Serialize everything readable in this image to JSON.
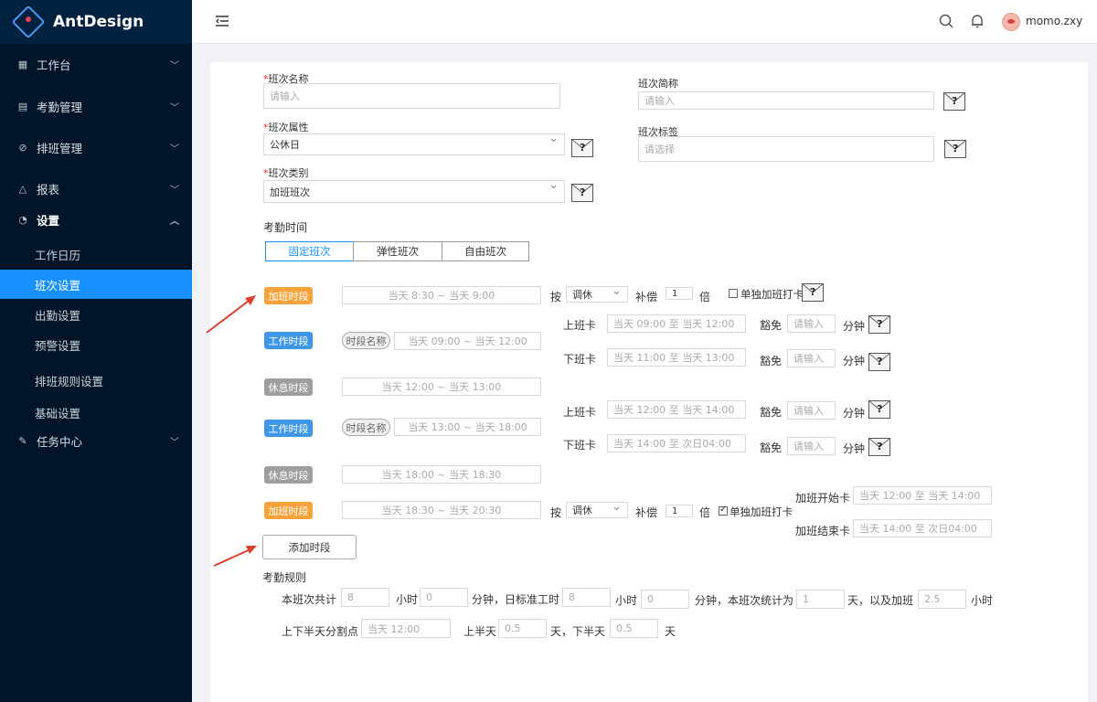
{
  "app": {
    "title": "AntDesign"
  },
  "sidebar": {
    "items": [
      {
        "label": "工作台",
        "icon": "table-icon"
      },
      {
        "label": "考勤管理",
        "icon": "file-icon"
      },
      {
        "label": "排班管理",
        "icon": "check-circle-icon"
      },
      {
        "label": "报表",
        "icon": "warning-icon"
      },
      {
        "label": "设置",
        "icon": "dashboard-icon",
        "expanded": true
      }
    ],
    "settings_sub": [
      "工作日历",
      "班次设置",
      "出勤设置",
      "预警设置",
      "排班规则设置",
      "基础设置"
    ],
    "active_sub": "班次设置",
    "task_center": {
      "label": "任务中心",
      "icon": "edit-icon"
    }
  },
  "header": {
    "username": "momo.zxy"
  },
  "form": {
    "shift_name": {
      "label": "班次名称",
      "placeholder": "请输入"
    },
    "shift_abbr": {
      "label": "班次简称",
      "placeholder": "请输入"
    },
    "shift_attr": {
      "label": "班次属性",
      "value": "公休日"
    },
    "shift_tag": {
      "label": "班次标签",
      "placeholder": "请选择"
    },
    "shift_type": {
      "label": "班次类别",
      "value": "加班班次"
    },
    "attendance_time_title": "考勤时间",
    "tabs": [
      "固定班次",
      "弹性班次",
      "自由班次"
    ],
    "active_tab": "固定班次"
  },
  "segments": [
    {
      "tag": "加班时段",
      "color": "orange",
      "time": "当天 8:30 ~ 当天 9:00"
    },
    {
      "tag": "工作时段",
      "color": "blue",
      "pill": "时段名称",
      "time": "当天 09:00 ~ 当天 12:00"
    },
    {
      "tag": "休息时段",
      "color": "gray",
      "time": "当天 12:00 ~ 当天 13:00"
    },
    {
      "tag": "工作时段",
      "color": "blue",
      "pill": "时段名称",
      "time": "当天 13:00 ~ 当天 18:00"
    },
    {
      "tag": "休息时段",
      "color": "gray",
      "time": "当天 18:00 ~ 当天 18:30"
    },
    {
      "tag": "加班时段",
      "color": "orange",
      "time": "当天 18:30 ~ 当天 20:30"
    }
  ],
  "overtime1": {
    "by": "按",
    "mode": "调休",
    "comp": "补偿",
    "times": "1",
    "unit": "倍",
    "check_label": "单独加班打卡",
    "checked": false
  },
  "overtime2": {
    "by": "按",
    "mode": "调休",
    "comp": "补偿",
    "times": "1",
    "unit": "倍",
    "check_label": "单独加班打卡",
    "checked": true
  },
  "punches": [
    {
      "label": "上班卡",
      "range": "当天 09:00 至  当天 12:00",
      "exempt": "豁免",
      "placeholder": "请输入",
      "unit": "分钟"
    },
    {
      "label": "下班卡",
      "range": "当天 11:00 至 当天 13:00",
      "exempt": "豁免",
      "placeholder": "请输入",
      "unit": "分钟"
    },
    {
      "label": "上班卡",
      "range": "当天 12:00 至  当天 14:00",
      "exempt": "豁免",
      "placeholder": "请输入",
      "unit": "分钟"
    },
    {
      "label": "下班卡",
      "range": "当天 14:00 至 次日04:00",
      "exempt": "豁免",
      "placeholder": "请输入",
      "unit": "分钟"
    }
  ],
  "overtime_cards": [
    {
      "label": "加班开始卡",
      "range": "当天 12:00 至  当天 14:00"
    },
    {
      "label": "加班结束卡",
      "range": "当天 14:00 至 次日04:00"
    }
  ],
  "add_segment_button": "添加时段",
  "rules": {
    "title": "考勤规则",
    "total_label": "本班次共计",
    "hours": "8",
    "hour_unit": "小时",
    "minutes": "0",
    "min_std_label": "分钟，日标准工时",
    "std_hours": "8",
    "hour_unit2": "小时",
    "std_minutes": "0",
    "count_label": "分钟，本班次统计为",
    "days": "1",
    "and_ot_label": "天，以及加班",
    "ot_hours": "2.5",
    "hour_unit3": "小时",
    "split_label": "上下半天分割点",
    "split_value": "当天 12:00",
    "first_half_label": "上半天",
    "first_half": "0.5",
    "second_half_label": "天，下半天",
    "second_half": "0.5",
    "day_unit": "天"
  }
}
